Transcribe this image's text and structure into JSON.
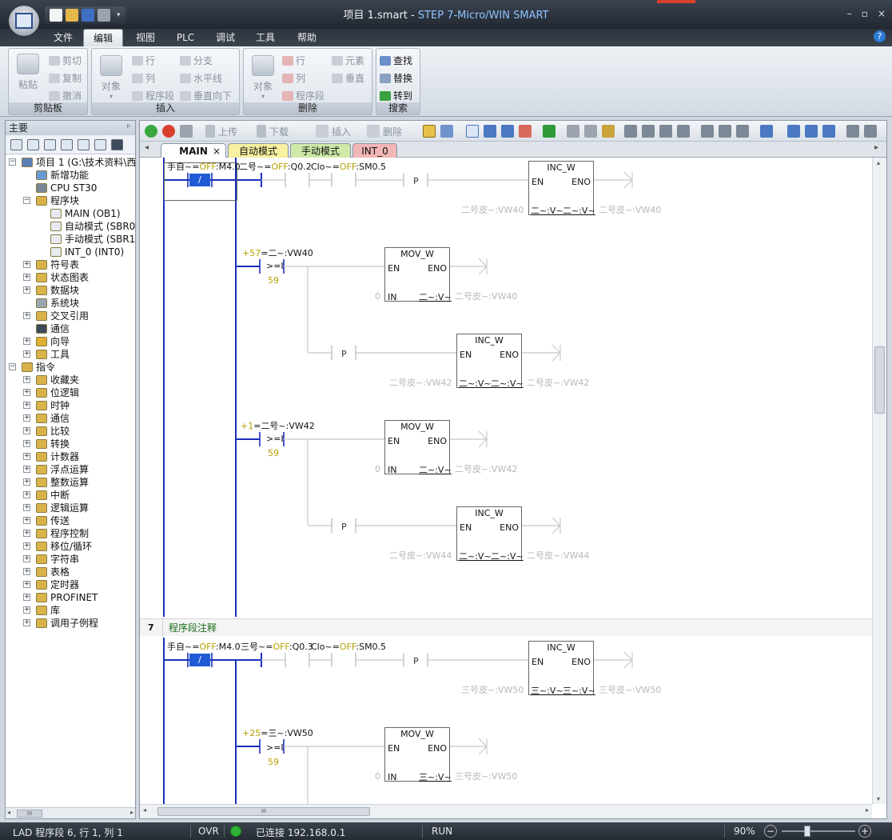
{
  "window": {
    "title_prefix": "项目 1.smart - ",
    "title_app": "STEP 7-Micro/WIN SMART",
    "min": "–",
    "max": "▫",
    "close": "×"
  },
  "menu": {
    "tabs": [
      "文件",
      "编辑",
      "视图",
      "PLC",
      "调试",
      "工具",
      "帮助"
    ],
    "active": "编辑",
    "help": "?"
  },
  "ribbon": {
    "clipboard": {
      "label": "剪贴板",
      "paste": "粘贴",
      "cut": "剪切",
      "copy": "复制",
      "undo": "撤消"
    },
    "insert": {
      "label": "插入",
      "object": "对象",
      "row": "行",
      "column": "列",
      "network": "程序段",
      "branch": "分支",
      "hline": "水平线",
      "vline": "垂直向下"
    },
    "delete": {
      "label": "删除",
      "object": "对象",
      "row": "行",
      "column": "列",
      "network": "程序段",
      "element": "元素",
      "vertical": "垂直"
    },
    "search": {
      "label": "搜索",
      "find": "查找",
      "replace": "替换",
      "goto": "转到"
    }
  },
  "left_panel": {
    "title": "主要",
    "pin": "ᵖ",
    "tree": [
      {
        "label": "项目 1 (G:\\技术资料\\西",
        "expander": "−",
        "icon": "#5b7fb8"
      },
      {
        "label": "新增功能",
        "expander": "",
        "icon": "#6a9ad6"
      },
      {
        "label": "CPU ST30",
        "expander": "",
        "icon": "#7b8797"
      },
      {
        "label": "程序块",
        "expander": "−",
        "icon": "#d9b24a"
      },
      {
        "label": "MAIN (OB1)",
        "expander": "",
        "icon": "#e7ebf0"
      },
      {
        "label": "自动模式 (SBR0",
        "expander": "",
        "icon": "#e7ebf0"
      },
      {
        "label": "手动模式 (SBR1",
        "expander": "",
        "icon": "#e7ebf0"
      },
      {
        "label": "INT_0 (INT0)",
        "expander": "",
        "icon": "#e7ebf0"
      },
      {
        "label": "符号表",
        "expander": "+",
        "icon": "#d9b24a"
      },
      {
        "label": "状态图表",
        "expander": "+",
        "icon": "#d9b24a"
      },
      {
        "label": "数据块",
        "expander": "+",
        "icon": "#d9b24a"
      },
      {
        "label": "系统块",
        "expander": "",
        "icon": "#9aa6b4"
      },
      {
        "label": "交叉引用",
        "expander": "+",
        "icon": "#d9b24a"
      },
      {
        "label": "通信",
        "expander": "",
        "icon": "#3d4a5c"
      },
      {
        "label": "向导",
        "expander": "+",
        "icon": "#e0b030"
      },
      {
        "label": "工具",
        "expander": "+",
        "icon": "#d9b24a"
      },
      {
        "label": "指令",
        "expander": "−",
        "icon": "#d9b24a"
      },
      {
        "label": "收藏夹",
        "expander": "+",
        "icon": "#d9b24a"
      },
      {
        "label": "位逻辑",
        "expander": "+",
        "icon": "#d9b24a"
      },
      {
        "label": "时钟",
        "expander": "+",
        "icon": "#d9b24a"
      },
      {
        "label": "通信",
        "expander": "+",
        "icon": "#d9b24a"
      },
      {
        "label": "比较",
        "expander": "+",
        "icon": "#d9b24a"
      },
      {
        "label": "转换",
        "expander": "+",
        "icon": "#d9b24a"
      },
      {
        "label": "计数器",
        "expander": "+",
        "icon": "#d9b24a"
      },
      {
        "label": "浮点运算",
        "expander": "+",
        "icon": "#d9b24a"
      },
      {
        "label": "整数运算",
        "expander": "+",
        "icon": "#d9b24a"
      },
      {
        "label": "中断",
        "expander": "+",
        "icon": "#d9b24a"
      },
      {
        "label": "逻辑运算",
        "expander": "+",
        "icon": "#d9b24a"
      },
      {
        "label": "传送",
        "expander": "+",
        "icon": "#d9b24a"
      },
      {
        "label": "程序控制",
        "expander": "+",
        "icon": "#d9b24a"
      },
      {
        "label": "移位/循环",
        "expander": "+",
        "icon": "#d9b24a"
      },
      {
        "label": "字符串",
        "expander": "+",
        "icon": "#d9b24a"
      },
      {
        "label": "表格",
        "expander": "+",
        "icon": "#d9b24a"
      },
      {
        "label": "定时器",
        "expander": "+",
        "icon": "#d9b24a"
      },
      {
        "label": "PROFINET",
        "expander": "+",
        "icon": "#d9b24a"
      },
      {
        "label": "库",
        "expander": "+",
        "icon": "#d9b24a"
      },
      {
        "label": "调用子例程",
        "expander": "+",
        "icon": "#d9b24a"
      }
    ],
    "scroll_grip": "III"
  },
  "editor_toolbar": {
    "upload": "上传",
    "download": "下载",
    "insert": "插入",
    "delete": "删除"
  },
  "tabs": [
    {
      "label": "MAIN",
      "close": "×",
      "color": "#ffffff"
    },
    {
      "label": "自动模式",
      "color": "#f6f0a0"
    },
    {
      "label": "手动模式",
      "color": "#cfe9a8"
    },
    {
      "label": "INT_0",
      "color": "#f2b6b6"
    }
  ],
  "colors": {
    "power_rail": "#1c2fbb",
    "off": "#b8a000",
    "inactive_wire": "#c8c8c8",
    "greyed": "#b8b8b8",
    "contact_active": "#1f5bd6",
    "comment": "#1a6b1a"
  },
  "ladder": {
    "network6": {
      "c1_name": "手自~",
      "eq": "=",
      "off": "OFF",
      "c1_addr": ":M4.0",
      "contact_glyph": "/",
      "c2_name": "二号~",
      "c2_addr": ":Q0.2",
      "c3_name": "Clo~",
      "c3_addr": ":SM0.5",
      "p": "P",
      "inc1": {
        "title": "INC_W",
        "en": "EN",
        "eno": "ENO",
        "in_label": "二号皮~:VW40",
        "in_val": "二~:V~",
        "out_val": "二~:V~",
        "out_label": "二号皮~:VW40"
      },
      "cmp1": {
        "prefix": "+57",
        "addr": "二~:VW40",
        "op": ">=I",
        "val": "59"
      },
      "mov1": {
        "title": "MOV_W",
        "en": "EN",
        "eno": "ENO",
        "in": "IN",
        "in_val": "0",
        "out_val": "二~:V~",
        "out_label": "二号皮~:VW40"
      },
      "inc2": {
        "title": "INC_W",
        "en": "EN",
        "eno": "ENO",
        "in_label": "二号皮~:VW42",
        "in_val": "二~:V~",
        "out_val": "二~:V~",
        "out_label": "二号皮~:VW42"
      },
      "cmp2": {
        "prefix": "+1",
        "addr": "二号~:VW42",
        "op": ">=I",
        "val": "59"
      },
      "mov2": {
        "title": "MOV_W",
        "en": "EN",
        "eno": "ENO",
        "in": "IN",
        "in_val": "0",
        "out_val": "二~:V~",
        "out_label": "二号皮~:VW42"
      },
      "inc3": {
        "title": "INC_W",
        "en": "EN",
        "eno": "ENO",
        "in_label": "二号皮~:VW44",
        "in_val": "二~:V~",
        "out_val": "二~:V~",
        "out_label": "二号皮~:VW44"
      }
    },
    "network7": {
      "number": "7",
      "comment": "程序段注释",
      "c1_name": "手自~",
      "eq": "=",
      "off": "OFF",
      "c1_addr": ":M4.0",
      "contact_glyph": "/",
      "c2_name": "三号~",
      "c2_addr": ":Q0.3",
      "c3_name": "Clo~",
      "c3_addr": ":SM0.5",
      "p": "P",
      "inc1": {
        "title": "INC_W",
        "en": "EN",
        "eno": "ENO",
        "in_label": "三号皮~:VW50",
        "in_val": "三~:V~",
        "out_val": "三~:V~",
        "out_label": "三号皮~:VW50"
      },
      "cmp1": {
        "prefix": "+25",
        "addr": "三~:VW50",
        "op": ">=I",
        "val": "59"
      },
      "mov1": {
        "title": "MOV_W",
        "en": "EN",
        "eno": "ENO",
        "in": "IN",
        "in_val": "0",
        "out_val": "三~:V~",
        "out_label": "三号皮~:VW50"
      }
    }
  },
  "hscroll_grip": "III",
  "status": {
    "position": "LAD 程序段 6, 行 1, 列 1",
    "mode": "OVR",
    "connection": "已连接 192.168.0.1",
    "run": "RUN",
    "zoom": "90%",
    "zoom_level": 0.3
  }
}
